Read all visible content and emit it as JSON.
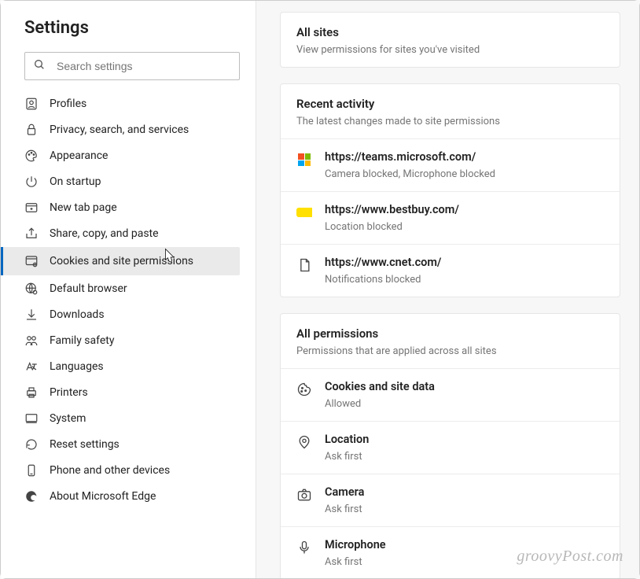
{
  "sidebar": {
    "title": "Settings",
    "search_placeholder": "Search settings",
    "items": [
      {
        "label": "Profiles",
        "icon": "profile-icon"
      },
      {
        "label": "Privacy, search, and services",
        "icon": "lock-icon"
      },
      {
        "label": "Appearance",
        "icon": "palette-icon"
      },
      {
        "label": "On startup",
        "icon": "power-icon"
      },
      {
        "label": "New tab page",
        "icon": "new-tab-icon"
      },
      {
        "label": "Share, copy, and paste",
        "icon": "share-icon"
      },
      {
        "label": "Cookies and site permissions",
        "icon": "permissions-icon"
      },
      {
        "label": "Default browser",
        "icon": "globe-icon"
      },
      {
        "label": "Downloads",
        "icon": "download-icon"
      },
      {
        "label": "Family safety",
        "icon": "family-icon"
      },
      {
        "label": "Languages",
        "icon": "language-icon"
      },
      {
        "label": "Printers",
        "icon": "printer-icon"
      },
      {
        "label": "System",
        "icon": "system-icon"
      },
      {
        "label": "Reset settings",
        "icon": "reset-icon"
      },
      {
        "label": "Phone and other devices",
        "icon": "phone-icon"
      },
      {
        "label": "About Microsoft Edge",
        "icon": "edge-icon"
      }
    ],
    "selected_index": 6
  },
  "allsites": {
    "title": "All sites",
    "subtitle": "View permissions for sites you've visited"
  },
  "recent": {
    "title": "Recent activity",
    "subtitle": "The latest changes made to site permissions",
    "items": [
      {
        "url": "https://teams.microsoft.com/",
        "status": "Camera blocked, Microphone blocked",
        "icon": "microsoft-icon"
      },
      {
        "url": "https://www.bestbuy.com/",
        "status": "Location blocked",
        "icon": "bestbuy-icon"
      },
      {
        "url": "https://www.cnet.com/",
        "status": "Notifications blocked",
        "icon": "page-icon"
      }
    ]
  },
  "allperms": {
    "title": "All permissions",
    "subtitle": "Permissions that are applied across all sites",
    "items": [
      {
        "name": "Cookies and site data",
        "status": "Allowed",
        "icon": "cookie-icon"
      },
      {
        "name": "Location",
        "status": "Ask first",
        "icon": "location-icon"
      },
      {
        "name": "Camera",
        "status": "Ask first",
        "icon": "camera-icon"
      },
      {
        "name": "Microphone",
        "status": "Ask first",
        "icon": "microphone-icon"
      }
    ]
  },
  "watermark": "groovyPost.com"
}
